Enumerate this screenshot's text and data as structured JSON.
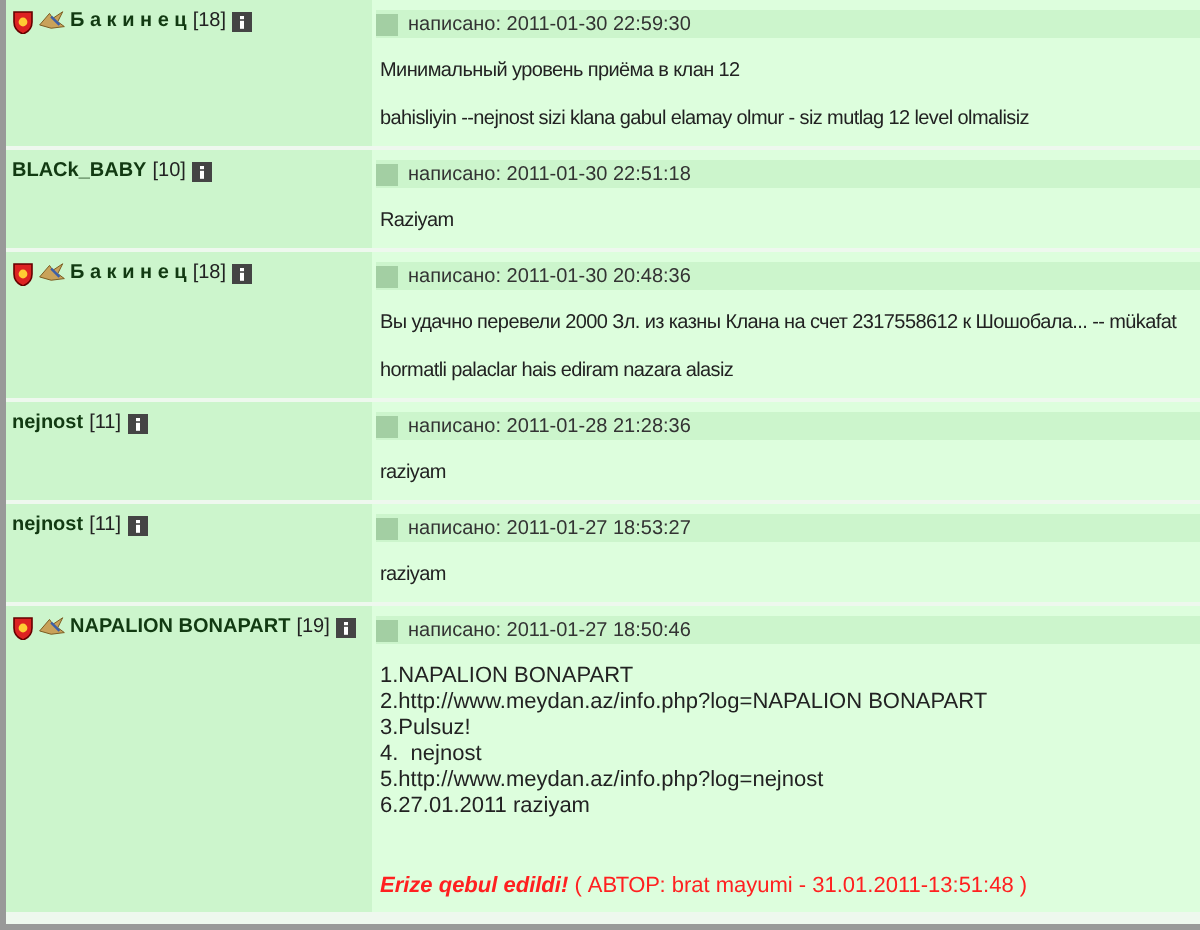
{
  "posts": [
    {
      "author": {
        "name": "Б а к и н е ц",
        "level": "[18]",
        "clan_badges": true
      },
      "posted": "написано: 2011-01-30 22:59:30",
      "paragraphs": [
        "Минимальный уровень приёма в клан 12",
        "bahisliyin --nejnost sizi klana gabul elamay olmur - siz mutlag 12 level olmalisiz"
      ]
    },
    {
      "author": {
        "name": "BLACk_BABY",
        "level": "[10]",
        "clan_badges": false
      },
      "posted": "написано: 2011-01-30 22:51:18",
      "paragraphs": [
        "Raziyam"
      ]
    },
    {
      "author": {
        "name": "Б а к и н е ц",
        "level": "[18]",
        "clan_badges": true
      },
      "posted": "написано: 2011-01-30 20:48:36",
      "paragraphs": [
        "Вы удачно перевели 2000 Зл. из казны Клана на счет 2317558612 к Шошобала... -- mükafat",
        "hormatli palaclar hais ediram nazara alasiz"
      ]
    },
    {
      "author": {
        "name": "nejnost",
        "level": "[11]",
        "clan_badges": false
      },
      "posted": "написано: 2011-01-28 21:28:36",
      "paragraphs": [
        "raziyam"
      ]
    },
    {
      "author": {
        "name": "nejnost",
        "level": "[11]",
        "clan_badges": false
      },
      "posted": "написано: 2011-01-27 18:53:27",
      "paragraphs": [
        "raziyam"
      ]
    },
    {
      "author": {
        "name": "NAPALION BONAPART",
        "level": "[19]",
        "clan_badges": true
      },
      "posted": "написано: 2011-01-27 18:50:46",
      "lines": [
        "1.NAPALION BONAPART",
        "2.http://www.meydan.az/info.php?log=NAPALION BONAPART",
        "3.Pulsuz!",
        "4.  nejnost",
        "5.http://www.meydan.az/info.php?log=nejnost",
        "6.27.01.2011 raziyam"
      ],
      "verdict": {
        "text": "Erize qebul edildi!",
        "detail": "( АВТОР: brat mayumi - 31.01.2011-13:51:48 )"
      }
    }
  ]
}
